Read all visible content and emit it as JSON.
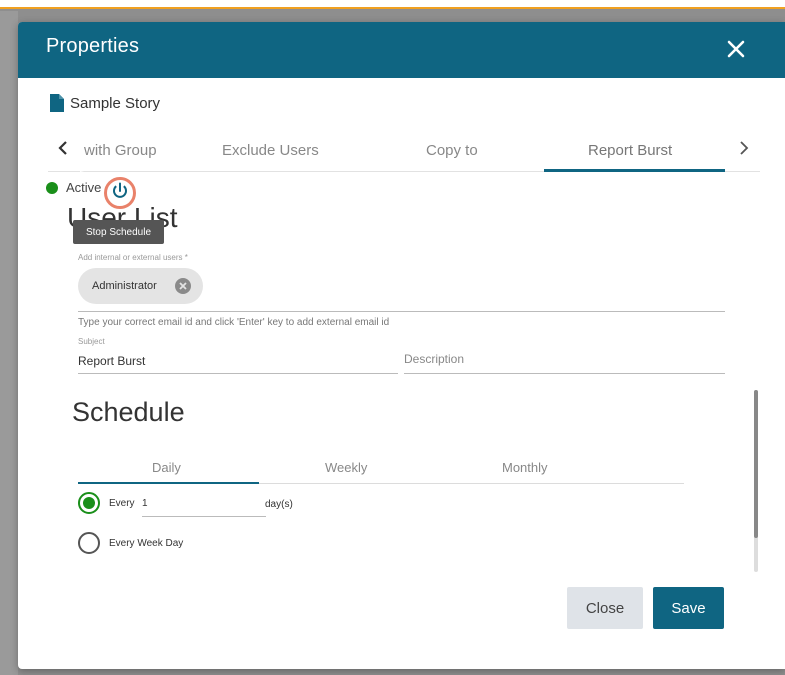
{
  "header": {
    "title": "Properties"
  },
  "story": {
    "label": "Sample Story"
  },
  "tabs": [
    {
      "label": "with Group"
    },
    {
      "label": "Exclude Users"
    },
    {
      "label": "Copy to"
    },
    {
      "label": "Report Burst"
    }
  ],
  "active_tab_index": 3,
  "status": {
    "label": "Active",
    "color": "#1a8f1a"
  },
  "tooltip": {
    "label": "Stop Schedule"
  },
  "user_list": {
    "heading": "User List",
    "field_label": "Add internal or external users *",
    "chips": [
      {
        "label": "Administrator"
      }
    ],
    "helper": "Type your correct email id and click 'Enter' key to add external email id"
  },
  "subject": {
    "label": "Subject",
    "value": "Report Burst"
  },
  "description": {
    "placeholder": "Description"
  },
  "schedule": {
    "heading": "Schedule",
    "tabs": [
      {
        "label": "Daily"
      },
      {
        "label": "Weekly"
      },
      {
        "label": "Monthly"
      }
    ],
    "active_tab_index": 0,
    "options": [
      {
        "label": "Every",
        "checked": true
      },
      {
        "label": "Every Week Day",
        "checked": false
      }
    ],
    "every_value": "1",
    "every_unit": "day(s)"
  },
  "buttons": {
    "close": "Close",
    "save": "Save"
  },
  "colors": {
    "accent": "#0f6582",
    "status_green": "#1a8f1a",
    "highlight": "#e9826a"
  }
}
